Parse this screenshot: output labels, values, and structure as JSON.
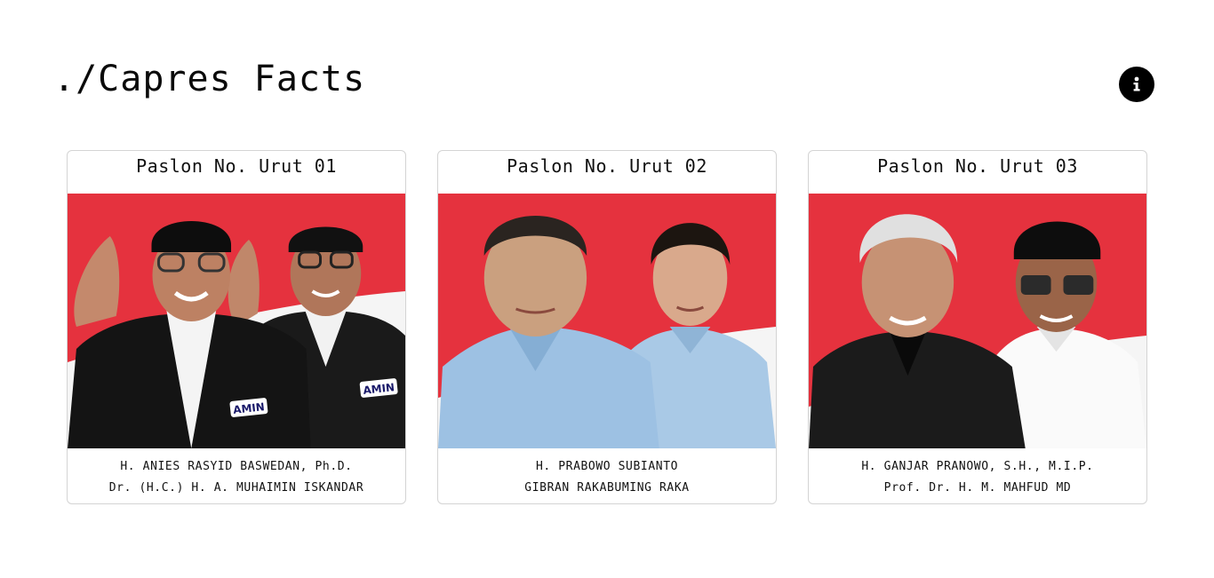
{
  "header": {
    "title": "./Capres Facts",
    "info_icon": "info-icon"
  },
  "colors": {
    "flag_red": "#e5323e",
    "flag_white": "#f5f5f5",
    "text": "#111111",
    "card_border": "#d4d4d4"
  },
  "candidates": [
    {
      "heading": "Paslon No. Urut 01",
      "president": "H. ANIES RASYID BASWEDAN, Ph.D.",
      "vice_president": "Dr. (H.C.) H. A. MUHAIMIN ISKANDAR",
      "badge_left": "AMIN",
      "badge_right": "AMIN"
    },
    {
      "heading": "Paslon No. Urut 02",
      "president": "H. PRABOWO SUBIANTO",
      "vice_president": "GIBRAN RAKABUMING RAKA"
    },
    {
      "heading": "Paslon No. Urut 03",
      "president": "H. GANJAR PRANOWO, S.H., M.I.P.",
      "vice_president": "Prof. Dr. H. M. MAHFUD MD"
    }
  ]
}
